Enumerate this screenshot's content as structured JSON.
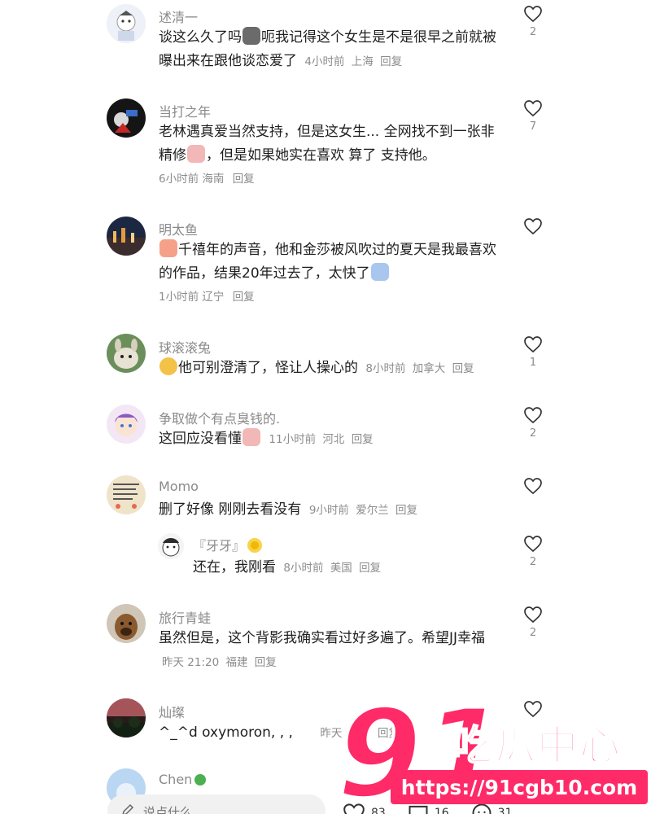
{
  "comments": [
    {
      "username": "述清一",
      "text_a": "谈这么久了吗",
      "text_b": "呃我记得这个女生是不是很早之前就被曝出来在跟他谈恋爱了",
      "time": "4小时前",
      "location": "上海",
      "reply_label": "回复",
      "likes": "2"
    },
    {
      "username": "当打之年",
      "text_a": "老林遇真爱当然支持，但是这女生... 全网找不到一张非精修",
      "text_b": "，但是如果她实在喜欢 算了 支持他。",
      "time": "6小时前",
      "location": "海南",
      "reply_label": "回复",
      "likes": "7"
    },
    {
      "username": "明太鱼",
      "text_a": "千禧年的声音，他和金莎被风吹过的夏天是我最喜欢的作品，结果20年过去了，太快了",
      "time": "1小时前",
      "location": "辽宁",
      "reply_label": "回复",
      "likes": ""
    },
    {
      "username": "球滚滚兔",
      "text_a": "他可别澄清了，怪让人操心的",
      "time": "8小时前",
      "location": "加拿大",
      "reply_label": "回复",
      "likes": "1"
    },
    {
      "username": "争取做个有点臭钱的.",
      "text_a": "这回应没看懂",
      "time": "11小时前",
      "location": "河北",
      "reply_label": "回复",
      "likes": "2"
    },
    {
      "username": "Momo",
      "text_a": "删了好像 刚刚去看没有",
      "time": "9小时前",
      "location": "爱尔兰",
      "reply_label": "回复",
      "likes": ""
    },
    {
      "username": "『牙牙』",
      "text_a": "还在，我刚看",
      "time": "8小时前",
      "location": "美国",
      "reply_label": "回复",
      "likes": "2"
    },
    {
      "username": "旅行青蛙",
      "text_a": "虽然但是，这个背影我确实看过好多遍了。希望JJ幸福",
      "time": "昨天 21:20",
      "location": "福建",
      "reply_label": "回复",
      "likes": "2"
    },
    {
      "username": "灿璨",
      "text_a": "^_^d oxymoron, , ,",
      "time": "昨天",
      "location": "湖南",
      "reply_label": "回复",
      "likes": ""
    },
    {
      "username": "Chen"
    }
  ],
  "input_bar": {
    "placeholder": "说点什么...",
    "likes": "83",
    "comments": "16",
    "shares": "31"
  },
  "watermark": {
    "number": "91",
    "brand": "吃瓜中心",
    "url": "https://91cgb10.com"
  },
  "colors": {
    "watermark": "#ff2a68",
    "muted_text": "#8c8c8c"
  }
}
